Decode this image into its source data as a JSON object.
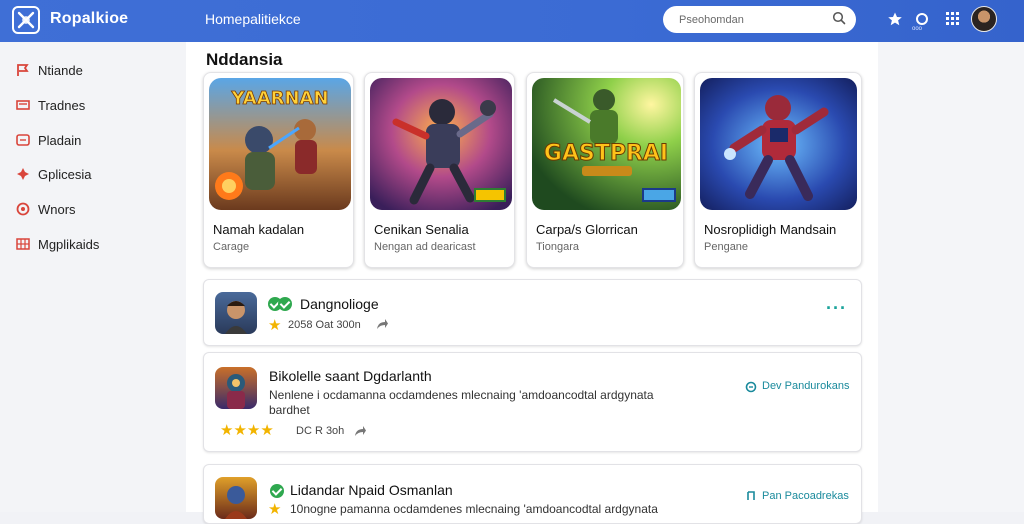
{
  "topbar": {
    "brand": "Ropalkioe",
    "section": "Homepalitiekce",
    "search_placeholder": "Pseohomdan",
    "notifications_sub": "ooo"
  },
  "sidebar": {
    "items": [
      {
        "label": "Ntiande",
        "icon": "flag-icon",
        "color": "#d9453b"
      },
      {
        "label": "Tradnes",
        "icon": "card-icon",
        "color": "#d9453b"
      },
      {
        "label": "Pladain",
        "icon": "list-icon",
        "color": "#d9453b"
      },
      {
        "label": "Gplicesia",
        "icon": "puzzle-icon",
        "color": "#d9453b"
      },
      {
        "label": "Wnors",
        "icon": "circle-icon",
        "color": "#d9453b"
      },
      {
        "label": "Mgplikaids",
        "icon": "grid-icon",
        "color": "#d9453b"
      }
    ]
  },
  "main": {
    "title": "Nddansia",
    "cards": [
      {
        "title": "Namah kadalan",
        "sub": "Carage",
        "art_text": "YAARNAN"
      },
      {
        "title": "Cenikan Senalia",
        "sub": "Nengan ad dearicast",
        "art_text": ""
      },
      {
        "title": "Carpa/s Glorrican",
        "sub": "Tiongara",
        "art_text": "GASTPRAI"
      },
      {
        "title": "Nosroplidigh Mandsain",
        "sub": "Pengane",
        "art_text": ""
      }
    ],
    "rows": [
      {
        "title": "Dangnolioge",
        "meta": "2058 Oat 300n",
        "link": ""
      },
      {
        "title": "Bikolelle saant Dgdarlanth",
        "text1": "Nenlene i ocdamanna ocdamdenes mlecnaing 'amdoancodtal ardgynata",
        "text2": "bardhet",
        "meta": "DC R 3oh",
        "link": "Dev Pandurokans"
      },
      {
        "title": "Lidandar Npaid Osmanlan",
        "text1": "10nogne pamanna ocdamdenes mlecnaing 'amdoancodtal ardgynata",
        "meta": "",
        "link": "Pan Pacoadrekas"
      }
    ]
  },
  "colors": {
    "topbar": "#3b6bd4",
    "accent_teal": "#1a8a9c",
    "star": "#f2b400",
    "check": "#2fa84f"
  }
}
